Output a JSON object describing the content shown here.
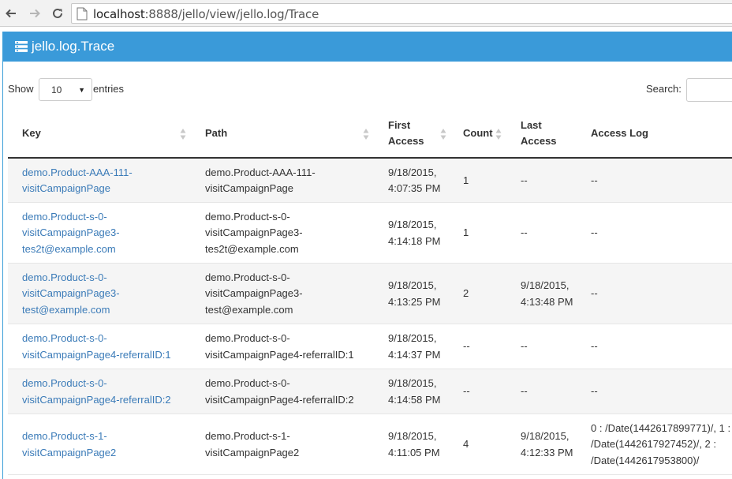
{
  "browser": {
    "url_host": "localhost",
    "url_rest": ":8888/jello/view/jello.log/Trace"
  },
  "header": {
    "title": "jello.log.Trace"
  },
  "controls": {
    "show_label": "Show",
    "page_length": "10",
    "entries_label": "entries",
    "search_label": "Search:",
    "search_value": ""
  },
  "table": {
    "columns": [
      {
        "label": "Key"
      },
      {
        "label": "Path"
      },
      {
        "label": "First\nAccess"
      },
      {
        "label": "Count"
      },
      {
        "label": "Last\nAccess"
      },
      {
        "label": "Access Log"
      }
    ],
    "rows": [
      {
        "key": "demo.Product-AAA-111-\nvisitCampaignPage",
        "path": "demo.Product-AAA-111-\nvisitCampaignPage",
        "first": "9/18/2015,\n4:07:35 PM",
        "count": "1",
        "last": "--",
        "log": "--"
      },
      {
        "key": "demo.Product-s-0-\nvisitCampaignPage3-\ntes2t@example.com",
        "path": "demo.Product-s-0-\nvisitCampaignPage3-\ntes2t@example.com",
        "first": "9/18/2015,\n4:14:18 PM",
        "count": "1",
        "last": "--",
        "log": "--"
      },
      {
        "key": "demo.Product-s-0-\nvisitCampaignPage3-\ntest@example.com",
        "path": "demo.Product-s-0-\nvisitCampaignPage3-\ntest@example.com",
        "first": "9/18/2015,\n4:13:25 PM",
        "count": "2",
        "last": "9/18/2015,\n4:13:48 PM",
        "log": "--"
      },
      {
        "key": "demo.Product-s-0-\nvisitCampaignPage4-referralID:1",
        "path": "demo.Product-s-0-\nvisitCampaignPage4-referralID:1",
        "first": "9/18/2015,\n4:14:37 PM",
        "count": "--",
        "last": "--",
        "log": "--"
      },
      {
        "key": "demo.Product-s-0-\nvisitCampaignPage4-referralID:2",
        "path": "demo.Product-s-0-\nvisitCampaignPage4-referralID:2",
        "first": "9/18/2015,\n4:14:58 PM",
        "count": "--",
        "last": "--",
        "log": "--"
      },
      {
        "key": "demo.Product-s-1-\nvisitCampaignPage2",
        "path": "demo.Product-s-1-\nvisitCampaignPage2",
        "first": "9/18/2015,\n4:11:05 PM",
        "count": "4",
        "last": "9/18/2015,\n4:12:33 PM",
        "log": "0 : /Date(1442617899771)/, 1 :\n/Date(1442617927452)/, 2 :\n/Date(1442617953800)/"
      }
    ]
  },
  "colors": {
    "header_bg": "#3a9ad9",
    "link": "#3b7bb8",
    "stripe": "#f5f5f5"
  }
}
